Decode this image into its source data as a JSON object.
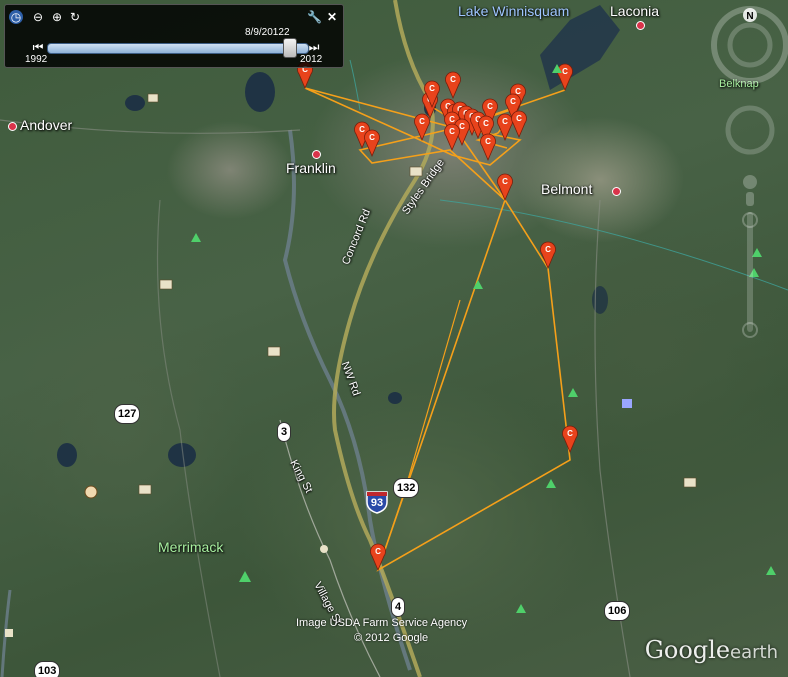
{
  "timeslider": {
    "start_year": "1992",
    "end_year": "2012",
    "current_date": "8/9/2012",
    "current_suffix": "2",
    "position": 0.93
  },
  "places": {
    "andover": "Andover",
    "franklin": "Franklin",
    "belmont": "Belmont",
    "laconia": "Laconia",
    "lake": "Lake Winnisquam",
    "belknap": "Belknap",
    "merrimack": "Merrimack"
  },
  "roads": {
    "concord_rd": "Concord Rd",
    "nw_rd": "NW Rd",
    "king_st": "King St",
    "village": "Village St",
    "styles_bridge": "Styles Bridge"
  },
  "shields": {
    "r3": "3",
    "r4": "4",
    "r93": "93",
    "r106": "106",
    "r127": "127",
    "r132": "132",
    "r103": "103"
  },
  "attribution": {
    "line1": "Image USDA Farm Service Agency",
    "line2": "© 2012 Google"
  },
  "logo": {
    "brand": "Google",
    "product": "earth"
  },
  "compass": {
    "north": "N"
  },
  "marker": {
    "glyph": "C",
    "color": "#e8431c"
  },
  "track_color": "#f5a01a"
}
